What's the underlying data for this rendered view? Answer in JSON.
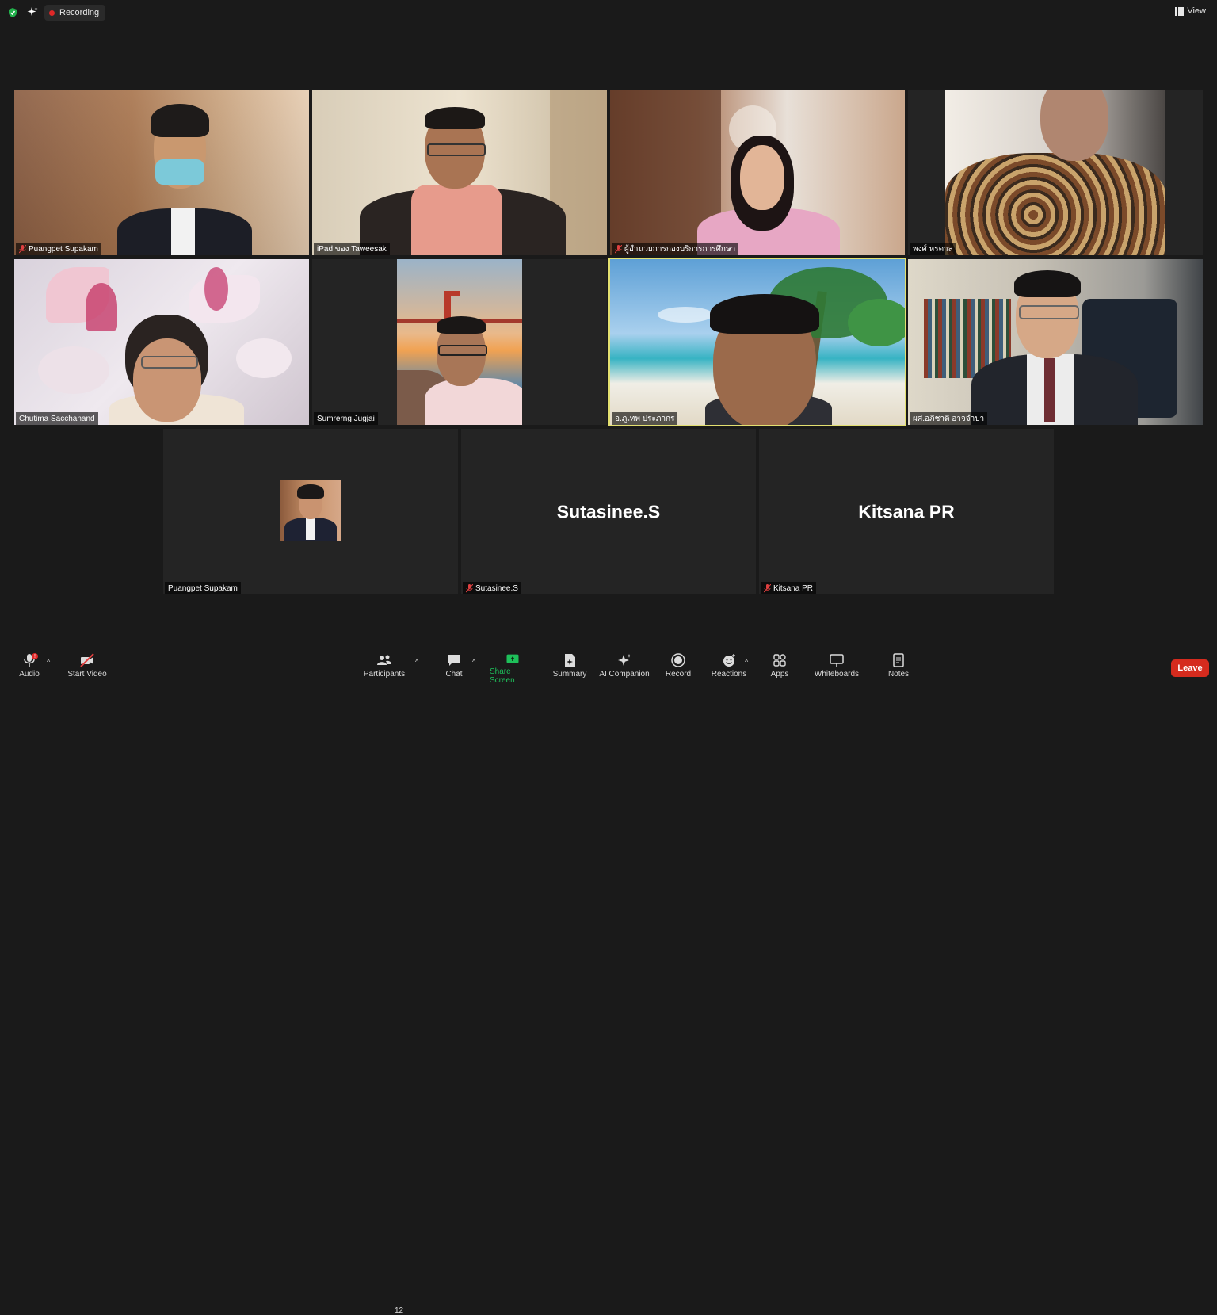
{
  "topbar": {
    "recording_label": "Recording",
    "view_label": "View"
  },
  "participants": [
    {
      "name": "Puangpet Supakam",
      "muted": true
    },
    {
      "name": "iPad ของ Taweesak",
      "muted": false
    },
    {
      "name": "ผู้อำนวยการกองบริการการศึกษา",
      "muted": true
    },
    {
      "name": "พงศ์ หรดาล",
      "muted": false
    },
    {
      "name": "Chutima  Sacchanand",
      "muted": false
    },
    {
      "name": "Sumrerng Jugjai",
      "muted": false
    },
    {
      "name": "อ.ภูเทพ ประภากร",
      "muted": false
    },
    {
      "name": "ผศ.อภิชาติ  อาจจำปา",
      "muted": false
    },
    {
      "name": "Puangpet Supakam",
      "muted": false
    },
    {
      "name": "Sutasinee.S",
      "muted": true,
      "display_name": "Sutasinee.S"
    },
    {
      "name": "Kitsana PR",
      "muted": true,
      "display_name": "Kitsana PR"
    }
  ],
  "toolbar": {
    "audio": "Audio",
    "start_video": "Start Video",
    "participants": "Participants",
    "participants_count": "12",
    "chat": "Chat",
    "share_screen": "Share Screen",
    "summary": "Summary",
    "ai_companion": "AI Companion",
    "record": "Record",
    "reactions": "Reactions",
    "apps": "Apps",
    "whiteboards": "Whiteboards",
    "notes": "Notes",
    "leave": "Leave"
  },
  "colors": {
    "active_speaker_border": "#e3e070",
    "leave_button": "#d52b1e",
    "share_screen": "#1ec05a",
    "recording_dot": "#e02828"
  }
}
